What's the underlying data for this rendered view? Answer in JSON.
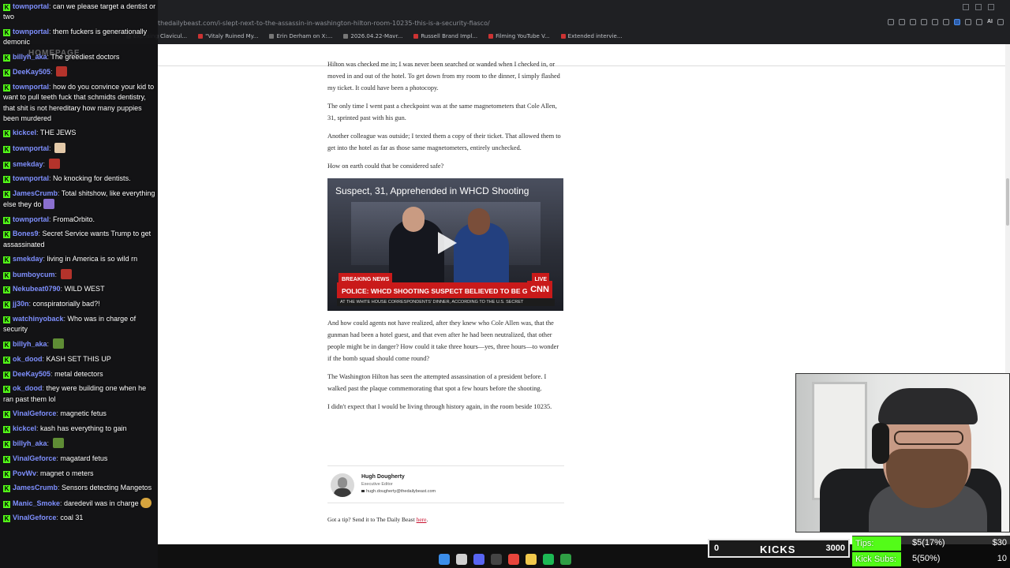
{
  "browser": {
    "url": "thedailybeast.com/i-slept-next-to-the-assassin-in-washington-hilton-room-10235-this-is-a-security-fiasco/",
    "bookmarks": [
      "Exposing Clavicul...",
      "\"Vitaly Ruined My...",
      "Erin Derham on X:...",
      "2026.04.22-Mavr...",
      "Russell Brand Impl...",
      "Filming YouTube V...",
      "Extended intervie..."
    ],
    "ai_label": "AI"
  },
  "article": {
    "paragraphs": [
      "Hilton was checked me in; I was never been searched or wanded when I checked in, or moved in and out of the hotel. To get down from my room to the dinner, I simply flashed my ticket. It could have been a photocopy.",
      "The only time I went past a checkpoint was at the same magnetometers that Cole Allen, 31, sprinted past with his gun.",
      "Another colleague was outside; I texted them a copy of their ticket. That allowed them to get into the hotel as far as those same magnetometers, entirely unchecked.",
      "How on earth could that be considered safe?"
    ],
    "video": {
      "title": "Suspect, 31, Apprehended in WHCD Shooting",
      "breaking": "BREAKING NEWS",
      "live": "LIVE",
      "chyron": "POLICE: WHCD SHOOTING SUSPECT BELIEVED TO BE GUEST AT HOTEL",
      "network": "CNN",
      "ticker": "AT THE WHITE HOUSE CORRESPONDENTS' DINNER, ACCORDING TO THE U.S. SECRET"
    },
    "paragraphs_after": [
      "And how could agents not have realized, after they knew who Cole Allen was, that the gunman had been a hotel guest, and that even after he had been neutralized, that other people might be in danger? How could it take three hours—yes, three hours—to wonder if the bomb squad should come round?",
      "The Washington Hilton has seen the attempted assassination of a president before. I walked past the plaque commemorating that spot a few hours before the shooting.",
      "I didn't expect that I would be living through history again, in the room beside 10235."
    ],
    "author": {
      "name": "Hugh Dougherty",
      "role": "Executive Editor",
      "email": "hugh.dougherty@thedailybeast.com"
    },
    "tip_prefix": "Got a tip? Send it to The Daily Beast ",
    "tip_link": "here",
    "tip_suffix": "."
  },
  "chat": {
    "ghost_text": "HOMEPAGE",
    "messages": [
      {
        "user": "townportal",
        "text": "can we please target a dentist or two",
        "emote": ""
      },
      {
        "user": "townportal",
        "text": "them fuckers is generationally demonic",
        "emote": ""
      },
      {
        "user": "billyh_aka",
        "text": "The greediest doctors",
        "emote": ""
      },
      {
        "user": "DeeKay505",
        "text": "",
        "emote": "red"
      },
      {
        "user": "townportal",
        "text": "how do you convince your kid to want to pull teeth fuck that schmidts dentistry, that shit is not hereditary how many puppies been murdered",
        "emote": ""
      },
      {
        "user": "kickcel",
        "text": "THE JEWS",
        "emote": ""
      },
      {
        "user": "townportal",
        "text": "",
        "emote": "tan"
      },
      {
        "user": "smekday",
        "text": "",
        "emote": "red"
      },
      {
        "user": "townportal",
        "text": "No knocking for dentists.",
        "emote": ""
      },
      {
        "user": "JamesCrumb",
        "text": "Total shitshow, like everything else they do",
        "emote": "purple"
      },
      {
        "user": "townportal",
        "text": "FromaOrbito.",
        "emote": ""
      },
      {
        "user": "Bones9",
        "text": "Secret Service wants Trump to get assassinated",
        "emote": ""
      },
      {
        "user": "smekday",
        "text": "living in America is so wild rn",
        "emote": ""
      },
      {
        "user": "bumboycum",
        "text": "",
        "emote": "red"
      },
      {
        "user": "Nekubeat0790",
        "text": "WILD WEST",
        "emote": ""
      },
      {
        "user": "jj30n",
        "text": "conspiratorially bad?!",
        "emote": ""
      },
      {
        "user": "watchinyoback",
        "text": "Who was in charge of security",
        "emote": ""
      },
      {
        "user": "billyh_aka",
        "text": "",
        "emote": "frog"
      },
      {
        "user": "ok_dood",
        "text": "KASH SET THIS UP",
        "emote": ""
      },
      {
        "user": "DeeKay505",
        "text": "metal detectors",
        "emote": ""
      },
      {
        "user": "ok_dood",
        "text": "they were building one when he ran past them lol",
        "emote": ""
      },
      {
        "user": "VinalGeforce",
        "text": "magnetic fetus",
        "emote": ""
      },
      {
        "user": "kickcel",
        "text": "kash has everything to gain",
        "emote": ""
      },
      {
        "user": "billyh_aka",
        "text": "",
        "emote": "frog"
      },
      {
        "user": "VinalGeforce",
        "text": "magatard fetus",
        "emote": ""
      },
      {
        "user": "PovWv",
        "text": "magnet o meters",
        "emote": ""
      },
      {
        "user": "JamesCrumb",
        "text": "Sensors detecting Mangetos",
        "emote": ""
      },
      {
        "user": "Manic_Smoke",
        "text": "daredevil was in charge",
        "emote": "shock"
      },
      {
        "user": "VinalGeforce",
        "text": "coal 31",
        "emote": ""
      }
    ]
  },
  "kicks": {
    "min": "0",
    "label": "KICKS",
    "max": "3000",
    "progress": 0.0
  },
  "stats": {
    "tips_label": "Tips:",
    "tips_mid": "$5(17%)",
    "tips_right": "$30",
    "subs_label": "Kick Subs:",
    "subs_mid": "5(50%)",
    "subs_right": "10"
  },
  "colors": {
    "kick_green": "#53fc18",
    "chat_user": "#7f90ff",
    "cnn_red": "#c91a1a",
    "link_red": "#c8102e"
  },
  "taskbar_icons": [
    "windows-icon",
    "search-icon",
    "discord-icon",
    "app-icon",
    "chrome-icon",
    "folder-icon",
    "spotify-icon",
    "xbox-icon"
  ]
}
